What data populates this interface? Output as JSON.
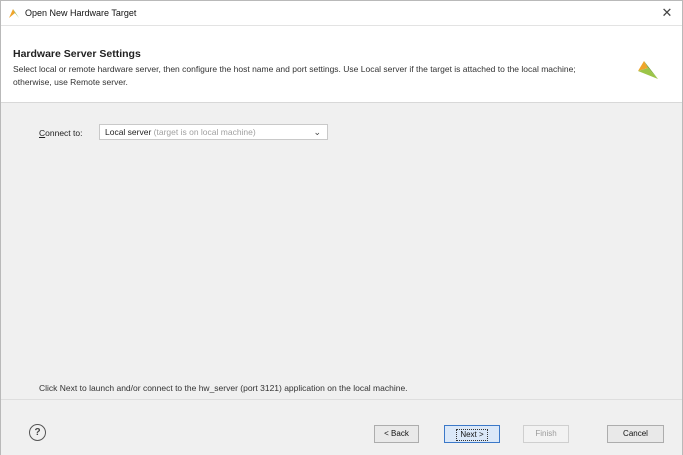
{
  "window": {
    "title": "Open New Hardware Target",
    "close_glyph": "✕"
  },
  "header": {
    "title": "Hardware Server Settings",
    "description": "Select local or remote hardware server, then configure the host name and port settings. Use Local server if the target is attached to the local machine; otherwise, use Remote server."
  },
  "form": {
    "connect_label_first": "C",
    "connect_label_rest": "onnect to:",
    "connect_value": "Local server",
    "connect_hint": " (target is on local machine)",
    "chevron_glyph": "⌄"
  },
  "footer_message": "Click Next to launch and/or connect to the hw_server (port 3121) application on the local machine.",
  "buttons": {
    "help": "?",
    "back": "< Back",
    "next": "Next >",
    "finish": "Finish",
    "cancel": "Cancel"
  },
  "colors": {
    "brand": "#8cb13a",
    "primary_border": "#3b78c8"
  }
}
